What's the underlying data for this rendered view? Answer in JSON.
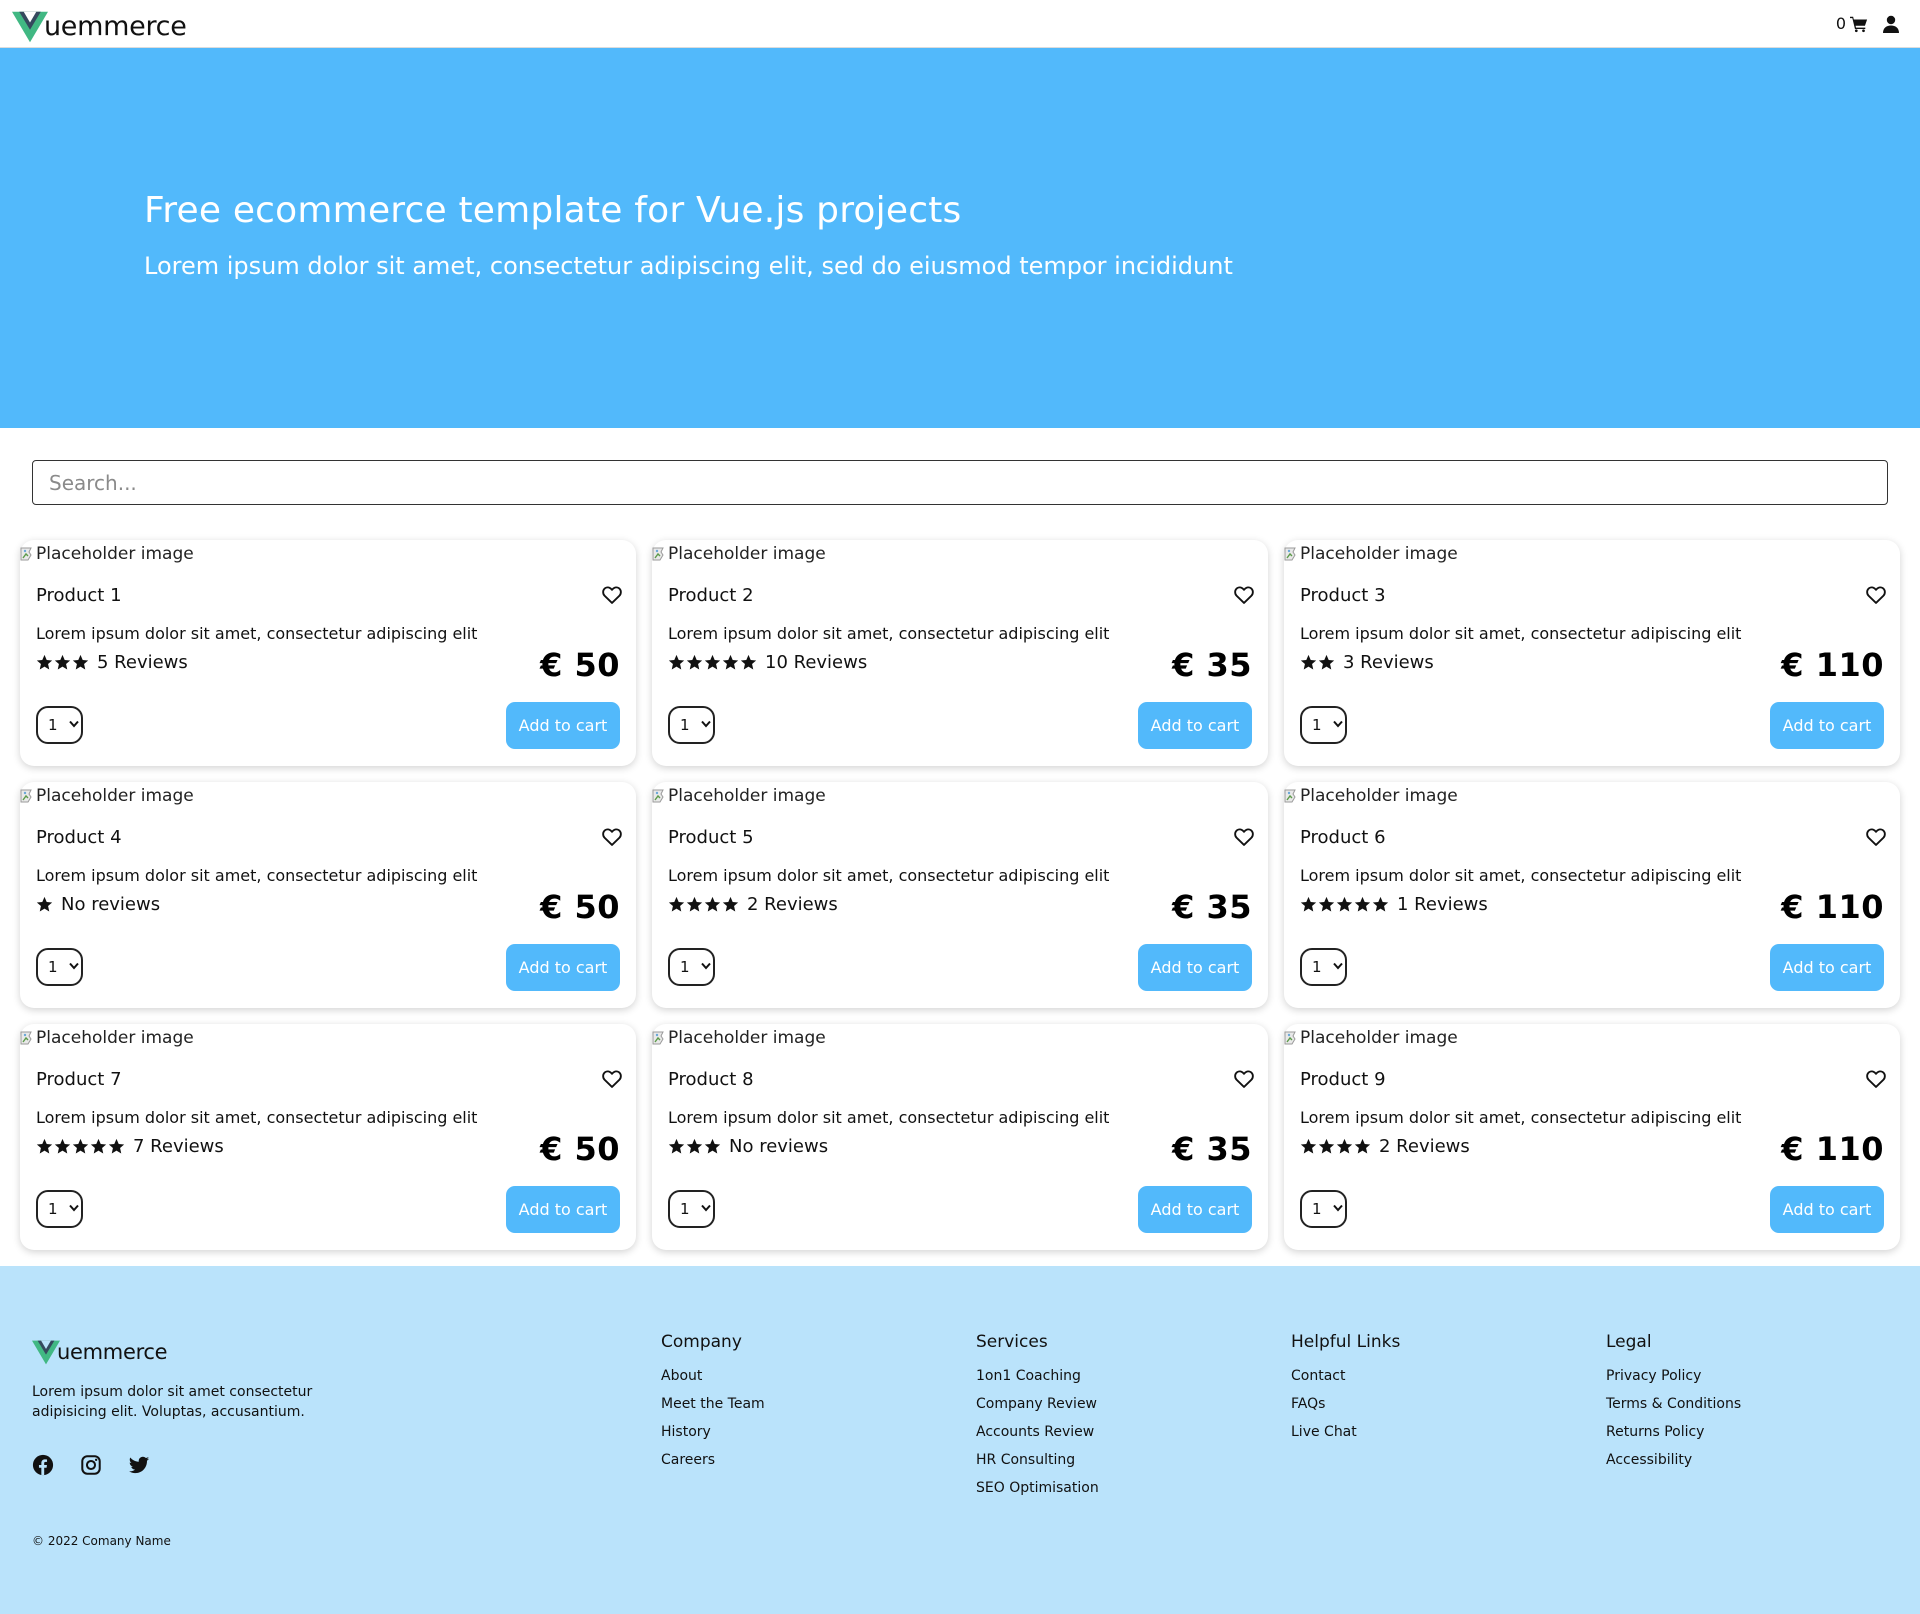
{
  "nav": {
    "brand": "uemmerce",
    "cart_count": "0"
  },
  "hero": {
    "title": "Free ecommerce template for Vue.js projects",
    "subtitle": "Lorem ipsum dolor sit amet, consectetur adipiscing elit, sed do eiusmod tempor incididunt"
  },
  "search": {
    "placeholder": "Search...",
    "value": ""
  },
  "product_card": {
    "image_alt": "Placeholder image",
    "add_to_cart_label": "Add to cart",
    "quantity_value": "1"
  },
  "products": [
    {
      "name": "Product 1",
      "description": "Lorem ipsum dolor sit amet, consectetur adipiscing elit",
      "stars": 3,
      "reviews": "5 Reviews",
      "price": "€ 50"
    },
    {
      "name": "Product 2",
      "description": "Lorem ipsum dolor sit amet, consectetur adipiscing elit",
      "stars": 5,
      "reviews": "10 Reviews",
      "price": "€ 35"
    },
    {
      "name": "Product 3",
      "description": "Lorem ipsum dolor sit amet, consectetur adipiscing elit",
      "stars": 2,
      "reviews": "3 Reviews",
      "price": "€ 110"
    },
    {
      "name": "Product 4",
      "description": "Lorem ipsum dolor sit amet, consectetur adipiscing elit",
      "stars": 1,
      "reviews": "No reviews",
      "price": "€ 50"
    },
    {
      "name": "Product 5",
      "description": "Lorem ipsum dolor sit amet, consectetur adipiscing elit",
      "stars": 4,
      "reviews": "2 Reviews",
      "price": "€ 35"
    },
    {
      "name": "Product 6",
      "description": "Lorem ipsum dolor sit amet, consectetur adipiscing elit",
      "stars": 5,
      "reviews": "1 Reviews",
      "price": "€ 110"
    },
    {
      "name": "Product 7",
      "description": "Lorem ipsum dolor sit amet, consectetur adipiscing elit",
      "stars": 5,
      "reviews": "7 Reviews",
      "price": "€ 50"
    },
    {
      "name": "Product 8",
      "description": "Lorem ipsum dolor sit amet, consectetur adipiscing elit",
      "stars": 3,
      "reviews": "No reviews",
      "price": "€ 35"
    },
    {
      "name": "Product 9",
      "description": "Lorem ipsum dolor sit amet, consectetur adipiscing elit",
      "stars": 4,
      "reviews": "2 Reviews",
      "price": "€ 110"
    }
  ],
  "footer": {
    "brand": "uemmerce",
    "about": "Lorem ipsum dolor sit amet consectetur adipisicing elit. Voluptas, accusantium.",
    "copyright": "© 2022 Comany Name",
    "socials": [
      "facebook-icon",
      "instagram-icon",
      "twitter-icon"
    ],
    "columns": [
      {
        "title": "Company",
        "links": [
          "About",
          "Meet the Team",
          "History",
          "Careers"
        ]
      },
      {
        "title": "Services",
        "links": [
          "1on1 Coaching",
          "Company Review",
          "Accounts Review",
          "HR Consulting",
          "SEO Optimisation"
        ]
      },
      {
        "title": "Helpful Links",
        "links": [
          "Contact",
          "FAQs",
          "Live Chat"
        ]
      },
      {
        "title": "Legal",
        "links": [
          "Privacy Policy",
          "Terms & Conditions",
          "Returns Policy",
          "Accessibility"
        ]
      }
    ]
  },
  "colors": {
    "accent": "#52b9fb",
    "footer_bg": "#bae3fb",
    "logo_green": "#41b883",
    "logo_dark": "#35495e"
  }
}
